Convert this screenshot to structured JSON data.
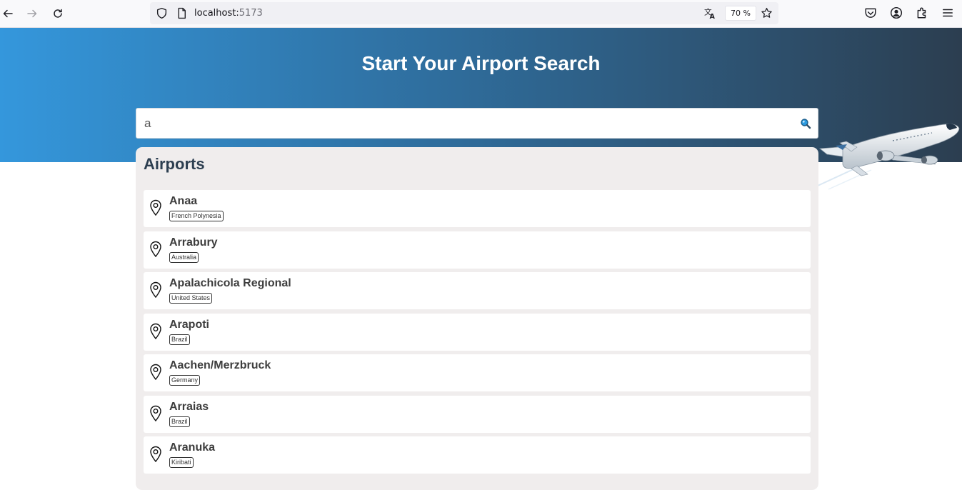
{
  "browser": {
    "url_host": "localhost:",
    "url_port": "5173",
    "zoom": "70 %"
  },
  "hero": {
    "title": "Start Your Airport Search"
  },
  "search": {
    "value": "a",
    "icon": "search-icon"
  },
  "results": {
    "title": "Airports",
    "items": [
      {
        "name": "Anaa",
        "country": "French Polynesia"
      },
      {
        "name": "Arrabury",
        "country": "Australia"
      },
      {
        "name": "Apalachicola Regional",
        "country": "United States"
      },
      {
        "name": "Arapoti",
        "country": "Brazil"
      },
      {
        "name": "Aachen/Merzbruck",
        "country": "Germany"
      },
      {
        "name": "Arraias",
        "country": "Brazil"
      },
      {
        "name": "Aranuka",
        "country": "Kiribati"
      }
    ]
  },
  "colors": {
    "hero_start": "#3497dc",
    "hero_end": "#2c3e50",
    "panel_bg": "#f0eded",
    "title_color": "#2c3e50"
  }
}
